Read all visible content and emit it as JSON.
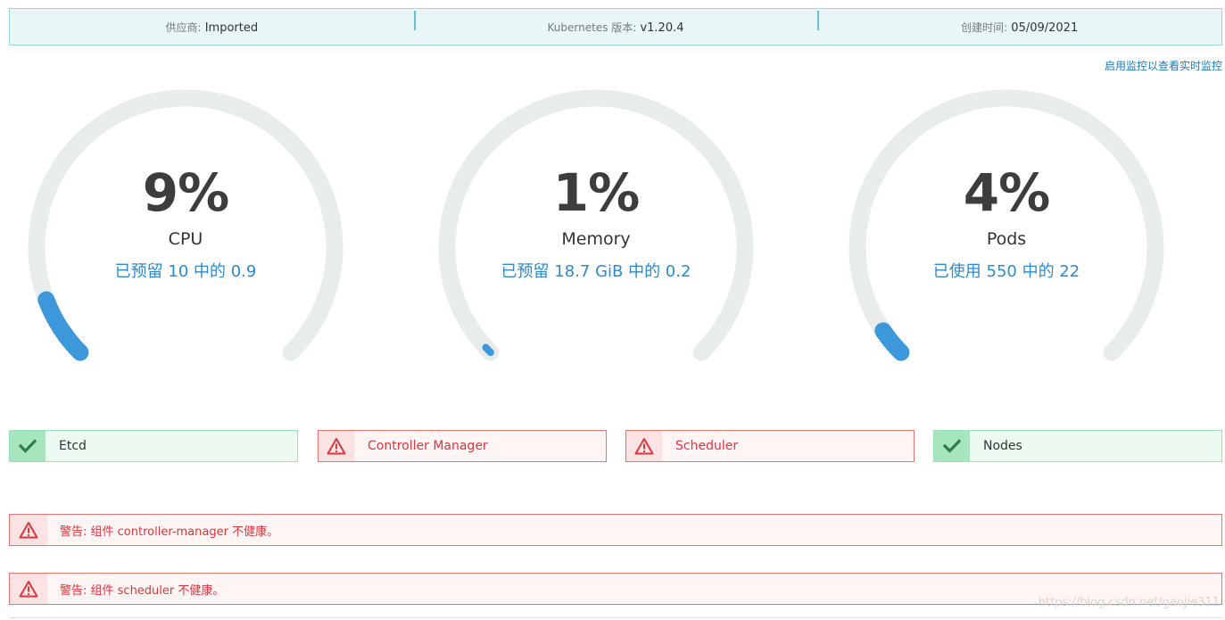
{
  "info": {
    "provider_label": "供应商:",
    "provider_value": "Imported",
    "k8s_label": "Kubernetes 版本:",
    "k8s_value": "v1.20.4",
    "created_label": "创建时间:",
    "created_value": "05/09/2021"
  },
  "monitor_link": "启用监控以查看实时监控",
  "gauges": [
    {
      "percent_label": "9%",
      "name": "CPU",
      "detail": "已预留 10 中的 0.9",
      "fraction": 0.09
    },
    {
      "percent_label": "1%",
      "name": "Memory",
      "detail": "已预留 18.7 GiB 中的 0.2",
      "fraction": 0.01
    },
    {
      "percent_label": "4%",
      "name": "Pods",
      "detail": "已使用 550 中的 22",
      "fraction": 0.04
    }
  ],
  "colors": {
    "gauge_track": "#e9eced",
    "gauge_fill": "#3d98db",
    "ok": "#2e7d4f",
    "error": "#d9363e"
  },
  "components": [
    {
      "name": "Etcd",
      "status": "ok",
      "icon": "check-icon"
    },
    {
      "name": "Controller Manager",
      "status": "error",
      "icon": "warning-icon"
    },
    {
      "name": "Scheduler",
      "status": "error",
      "icon": "warning-icon"
    },
    {
      "name": "Nodes",
      "status": "ok",
      "icon": "check-icon"
    }
  ],
  "alerts": [
    {
      "text": "警告: 组件 controller-manager 不健康。",
      "icon": "warning-icon"
    },
    {
      "text": "警告: 组件 scheduler 不健康。",
      "icon": "warning-icon"
    }
  ],
  "watermark": "https://blog.csdn.net/gaojie311"
}
